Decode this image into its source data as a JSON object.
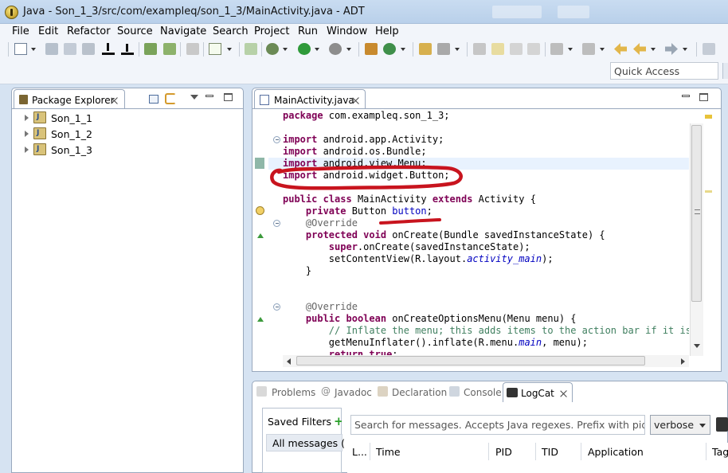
{
  "window": {
    "title": "Java - Son_1_3/src/com/exampleq/son_1_3/MainActivity.java - ADT"
  },
  "menu": [
    "File",
    "Edit",
    "Refactor",
    "Source",
    "Navigate",
    "Search",
    "Project",
    "Run",
    "Window",
    "Help"
  ],
  "quick_access": {
    "placeholder": "Quick Access"
  },
  "package_explorer": {
    "tab_label": "Package Explorer",
    "projects": [
      "Son_1_1",
      "Son_1_2",
      "Son_1_3"
    ]
  },
  "editor": {
    "tab_label": "MainActivity.java",
    "lines": {
      "l1_kw": "package",
      "l1_rest": " com.exampleq.son_1_3;",
      "imp": "import",
      "l3_rest": " android.app.Activity;",
      "l4_rest": " android.os.Bundle;",
      "l5_rest": " android.view.Menu;",
      "l6_rest": " android.widget.Button;",
      "l8_public": "public",
      "l8_class": "class",
      "l8_name": " MainActivity ",
      "l8_extends": "extends",
      "l8_rest": " Activity {",
      "l9_private": "private",
      "l9_type": " Button ",
      "l9_field": "button",
      "l9_semi": ";",
      "override": "@Override",
      "l11_protected": "protected",
      "l11_void": "void",
      "l11_rest": " onCreate(Bundle savedInstanceState) {",
      "l12_super": "super",
      "l12_rest": ".onCreate(savedInstanceState);",
      "l13_a": "setContentView(R.layout.",
      "l13_it": "activity_main",
      "l13_b": ");",
      "l14": "}",
      "l18_boolean": "boolean",
      "l18_rest": " onCreateOptionsMenu(Menu menu) {",
      "l19_comment": "// Inflate the menu; this adds items to the action bar if it is p",
      "l20_a": "getMenuInflater().inflate(R.menu.",
      "l20_it": "main",
      "l20_b": ", menu);",
      "l21_return": "return",
      "l21_true": "true",
      "l21_semi": ";"
    }
  },
  "bottom_tabs": {
    "problems": "Problems",
    "javadoc": "Javadoc",
    "declaration": "Declaration",
    "console": "Console",
    "logcat": "LogCat"
  },
  "logcat": {
    "saved_filters": "Saved Filters",
    "all_messages": "All messages (",
    "search_placeholder": "Search for messages. Accepts Java regexes. Prefix with pid:, app:, tag: or text: to",
    "level": "verbose",
    "columns": [
      "L...",
      "Time",
      "PID",
      "TID",
      "Application",
      "Tag"
    ]
  },
  "colors": {
    "annotation": "#c8141e",
    "keyword": "#7f0055",
    "comment": "#3f7f5f"
  }
}
